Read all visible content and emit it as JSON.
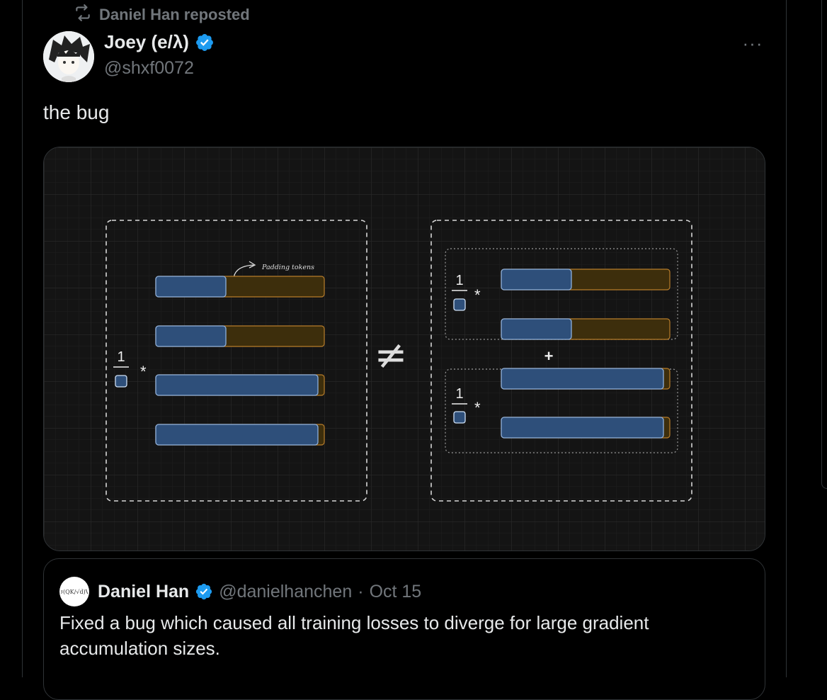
{
  "repost": {
    "label": "Daniel Han reposted"
  },
  "tweet": {
    "author_name": "Joey (e/λ)",
    "author_handle": "@shxf0072",
    "text": "the bug",
    "more_label": "···"
  },
  "diagram": {
    "annotation": "Padding tokens",
    "fraction_numerator": "1",
    "multiply": "*",
    "not_equal": "≠",
    "plus": "+"
  },
  "quote": {
    "author_name": "Daniel Han",
    "author_handle": "@danielhanchen",
    "separator": "·",
    "date": "Oct 15",
    "text": "Fixed a bug which caused all training losses to diverge for large gradient accumulation sizes."
  },
  "colors": {
    "background": "#000000",
    "text": "#e7e9ea",
    "muted": "#71767b",
    "verified": "#1d9bf0",
    "token_blue": "#2e4f7a",
    "padding_orange": "#3d2e0c"
  }
}
